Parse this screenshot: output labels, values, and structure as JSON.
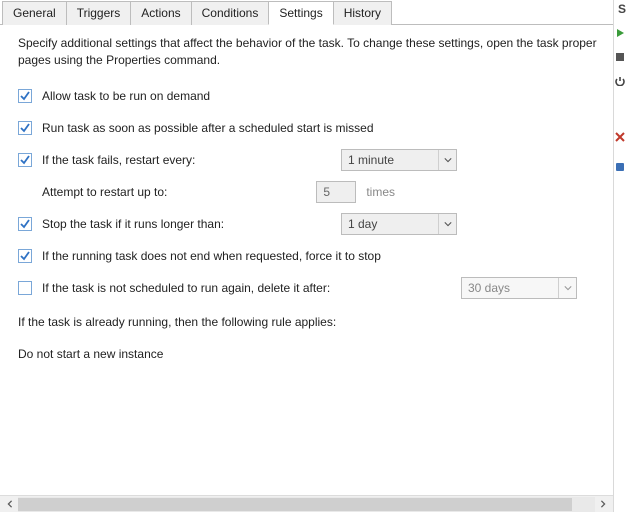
{
  "tabs": {
    "items": [
      {
        "label": "General"
      },
      {
        "label": "Triggers"
      },
      {
        "label": "Actions"
      },
      {
        "label": "Conditions"
      },
      {
        "label": "Settings"
      },
      {
        "label": "History"
      }
    ],
    "active_index": 4
  },
  "intro": {
    "line1": "Specify additional settings that affect the behavior of the task. To change these settings, open the task proper",
    "line2": "pages using the Properties command."
  },
  "settings": {
    "allow_demand": {
      "checked": true,
      "label": "Allow task to be run on demand"
    },
    "run_asap": {
      "checked": true,
      "label": "Run task as soon as possible after a scheduled start is missed"
    },
    "restart_every": {
      "checked": true,
      "label": "If the task fails, restart every:",
      "value": "1 minute"
    },
    "attempt": {
      "label": "Attempt to restart up to:",
      "value": "5",
      "suffix": "times"
    },
    "stop_longer": {
      "checked": true,
      "label": "Stop the task if it runs longer than:",
      "value": "1 day"
    },
    "force_stop": {
      "checked": true,
      "label": "If the running task does not end when requested, force it to stop"
    },
    "delete_after": {
      "checked": false,
      "label": "If the task is not scheduled to run again, delete it after:",
      "value": "30 days"
    },
    "rule_intro": "If the task is already running, then the following rule applies:",
    "rule_value": "Do not start a new instance"
  },
  "right_strip": {
    "header": "S"
  }
}
